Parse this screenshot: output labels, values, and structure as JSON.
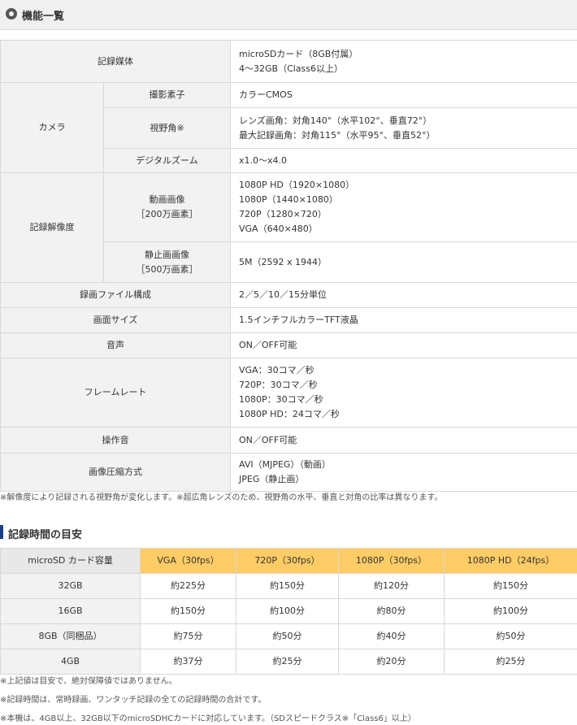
{
  "header": {
    "title": "機能一覧"
  },
  "spec": {
    "storage": {
      "label": "記録媒体",
      "lines": [
        "microSDカード（8GB付属）",
        "4～32GB（Class6以上）"
      ]
    },
    "camera": {
      "label": "カメラ",
      "sensor": {
        "label": "撮影素子",
        "value": "カラーCMOS"
      },
      "fov": {
        "label": "視野角※",
        "lines": [
          "レンズ画角：対角140°（水平102°、垂直72°）",
          "最大記録画角：対角115°（水平95°、垂直52°）"
        ]
      },
      "zoom": {
        "label": "デジタルズーム",
        "value": "x1.0～x4.0"
      }
    },
    "resolution": {
      "label": "記録解像度",
      "video": {
        "label1": "動画画像",
        "label2": "［200万画素］",
        "lines": [
          "1080P HD（1920×1080）",
          "1080P（1440×1080）",
          "720P（1280×720）",
          "VGA（640×480）"
        ]
      },
      "still": {
        "label1": "静止画画像",
        "label2": "［500万画素］",
        "value": "5M（2592 x 1944）"
      }
    },
    "file": {
      "label": "録画ファイル構成",
      "value": "2／5／10／15分単位"
    },
    "screen": {
      "label": "画面サイズ",
      "value": "1.5インチフルカラーTFT液晶"
    },
    "audio": {
      "label": "音声",
      "value": "ON／OFF可能"
    },
    "framerate": {
      "label": "フレームレート",
      "lines": [
        "VGA：30コマ／秒",
        "720P：30コマ／秒",
        "1080P：30コマ／秒",
        "1080P HD：24コマ／秒"
      ]
    },
    "beep": {
      "label": "操作音",
      "value": "ON／OFF可能"
    },
    "compression": {
      "label": "画像圧縮方式",
      "lines": [
        "AVI（MJPEG）（動画）",
        "JPEG（静止画）"
      ]
    }
  },
  "note1": "※解像度により記録される視野角が変化します。※超広角レンズのため、視野角の水平、垂直と対角の比率は異なります。",
  "record_section": {
    "title": "記録時間の目安"
  },
  "record_table": {
    "headers": [
      "microSD カード容量",
      "VGA（30fps）",
      "720P（30fps）",
      "1080P（30fps）",
      "1080P HD（24fps）"
    ],
    "rows": [
      [
        "32GB",
        "約225分",
        "約150分",
        "約120分",
        "約150分"
      ],
      [
        "16GB",
        "約150分",
        "約100分",
        "約80分",
        "約100分"
      ],
      [
        "8GB（同梱品）",
        "約75分",
        "約50分",
        "約40分",
        "約50分"
      ],
      [
        "4GB",
        "約37分",
        "約25分",
        "約20分",
        "約25分"
      ]
    ]
  },
  "notes2": [
    "※上記値は目安で、絶対保障値ではありません。",
    "※記録時間は、常時録画、ワンタッチ記録の全ての記録時間の合計です。",
    "※本機は、4GB以上、32GB以下のmicroSDHCカードに対応しています。（SDスピードクラス※「Class6」以上）"
  ],
  "colors": {
    "label_bg": "#f2f2f2",
    "header_orange": "#ffcc66",
    "accent_blue": "#1c3f8c"
  }
}
